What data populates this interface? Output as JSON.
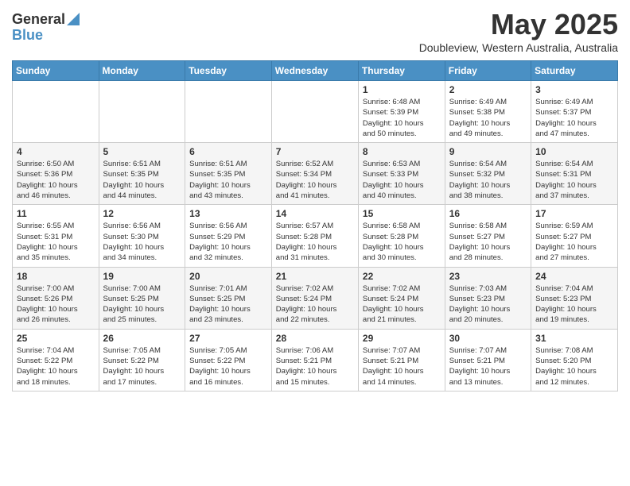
{
  "logo": {
    "general": "General",
    "blue": "Blue"
  },
  "title": "May 2025",
  "location": "Doubleview, Western Australia, Australia",
  "days_of_week": [
    "Sunday",
    "Monday",
    "Tuesday",
    "Wednesday",
    "Thursday",
    "Friday",
    "Saturday"
  ],
  "weeks": [
    [
      {
        "day": "",
        "info": ""
      },
      {
        "day": "",
        "info": ""
      },
      {
        "day": "",
        "info": ""
      },
      {
        "day": "",
        "info": ""
      },
      {
        "day": "1",
        "info": "Sunrise: 6:48 AM\nSunset: 5:39 PM\nDaylight: 10 hours\nand 50 minutes."
      },
      {
        "day": "2",
        "info": "Sunrise: 6:49 AM\nSunset: 5:38 PM\nDaylight: 10 hours\nand 49 minutes."
      },
      {
        "day": "3",
        "info": "Sunrise: 6:49 AM\nSunset: 5:37 PM\nDaylight: 10 hours\nand 47 minutes."
      }
    ],
    [
      {
        "day": "4",
        "info": "Sunrise: 6:50 AM\nSunset: 5:36 PM\nDaylight: 10 hours\nand 46 minutes."
      },
      {
        "day": "5",
        "info": "Sunrise: 6:51 AM\nSunset: 5:35 PM\nDaylight: 10 hours\nand 44 minutes."
      },
      {
        "day": "6",
        "info": "Sunrise: 6:51 AM\nSunset: 5:35 PM\nDaylight: 10 hours\nand 43 minutes."
      },
      {
        "day": "7",
        "info": "Sunrise: 6:52 AM\nSunset: 5:34 PM\nDaylight: 10 hours\nand 41 minutes."
      },
      {
        "day": "8",
        "info": "Sunrise: 6:53 AM\nSunset: 5:33 PM\nDaylight: 10 hours\nand 40 minutes."
      },
      {
        "day": "9",
        "info": "Sunrise: 6:54 AM\nSunset: 5:32 PM\nDaylight: 10 hours\nand 38 minutes."
      },
      {
        "day": "10",
        "info": "Sunrise: 6:54 AM\nSunset: 5:31 PM\nDaylight: 10 hours\nand 37 minutes."
      }
    ],
    [
      {
        "day": "11",
        "info": "Sunrise: 6:55 AM\nSunset: 5:31 PM\nDaylight: 10 hours\nand 35 minutes."
      },
      {
        "day": "12",
        "info": "Sunrise: 6:56 AM\nSunset: 5:30 PM\nDaylight: 10 hours\nand 34 minutes."
      },
      {
        "day": "13",
        "info": "Sunrise: 6:56 AM\nSunset: 5:29 PM\nDaylight: 10 hours\nand 32 minutes."
      },
      {
        "day": "14",
        "info": "Sunrise: 6:57 AM\nSunset: 5:28 PM\nDaylight: 10 hours\nand 31 minutes."
      },
      {
        "day": "15",
        "info": "Sunrise: 6:58 AM\nSunset: 5:28 PM\nDaylight: 10 hours\nand 30 minutes."
      },
      {
        "day": "16",
        "info": "Sunrise: 6:58 AM\nSunset: 5:27 PM\nDaylight: 10 hours\nand 28 minutes."
      },
      {
        "day": "17",
        "info": "Sunrise: 6:59 AM\nSunset: 5:27 PM\nDaylight: 10 hours\nand 27 minutes."
      }
    ],
    [
      {
        "day": "18",
        "info": "Sunrise: 7:00 AM\nSunset: 5:26 PM\nDaylight: 10 hours\nand 26 minutes."
      },
      {
        "day": "19",
        "info": "Sunrise: 7:00 AM\nSunset: 5:25 PM\nDaylight: 10 hours\nand 25 minutes."
      },
      {
        "day": "20",
        "info": "Sunrise: 7:01 AM\nSunset: 5:25 PM\nDaylight: 10 hours\nand 23 minutes."
      },
      {
        "day": "21",
        "info": "Sunrise: 7:02 AM\nSunset: 5:24 PM\nDaylight: 10 hours\nand 22 minutes."
      },
      {
        "day": "22",
        "info": "Sunrise: 7:02 AM\nSunset: 5:24 PM\nDaylight: 10 hours\nand 21 minutes."
      },
      {
        "day": "23",
        "info": "Sunrise: 7:03 AM\nSunset: 5:23 PM\nDaylight: 10 hours\nand 20 minutes."
      },
      {
        "day": "24",
        "info": "Sunrise: 7:04 AM\nSunset: 5:23 PM\nDaylight: 10 hours\nand 19 minutes."
      }
    ],
    [
      {
        "day": "25",
        "info": "Sunrise: 7:04 AM\nSunset: 5:22 PM\nDaylight: 10 hours\nand 18 minutes."
      },
      {
        "day": "26",
        "info": "Sunrise: 7:05 AM\nSunset: 5:22 PM\nDaylight: 10 hours\nand 17 minutes."
      },
      {
        "day": "27",
        "info": "Sunrise: 7:05 AM\nSunset: 5:22 PM\nDaylight: 10 hours\nand 16 minutes."
      },
      {
        "day": "28",
        "info": "Sunrise: 7:06 AM\nSunset: 5:21 PM\nDaylight: 10 hours\nand 15 minutes."
      },
      {
        "day": "29",
        "info": "Sunrise: 7:07 AM\nSunset: 5:21 PM\nDaylight: 10 hours\nand 14 minutes."
      },
      {
        "day": "30",
        "info": "Sunrise: 7:07 AM\nSunset: 5:21 PM\nDaylight: 10 hours\nand 13 minutes."
      },
      {
        "day": "31",
        "info": "Sunrise: 7:08 AM\nSunset: 5:20 PM\nDaylight: 10 hours\nand 12 minutes."
      }
    ]
  ]
}
